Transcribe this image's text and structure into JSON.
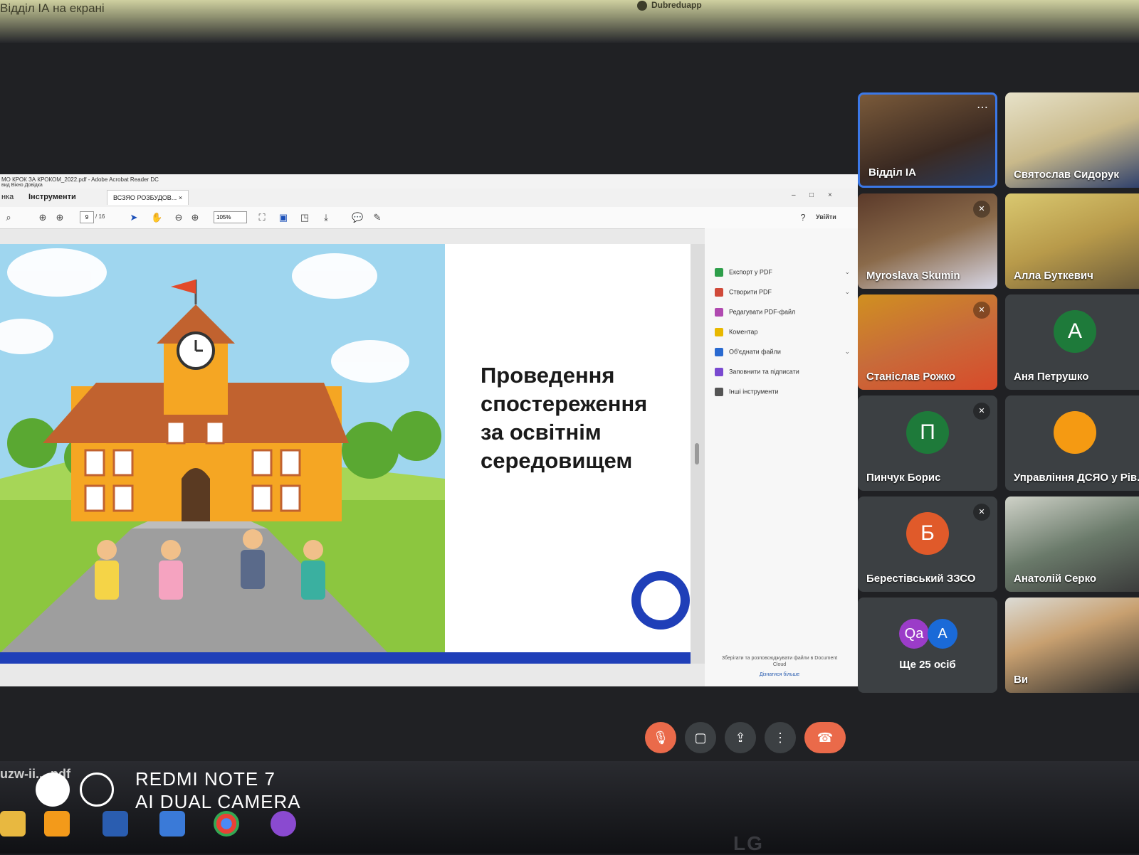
{
  "top": {
    "presenting_label": "Відділ ІА на екрані",
    "brand": "Dubreduapp"
  },
  "window": {
    "title": "МО КРОК ЗА КРОКОМ_2022.pdf - Adobe Acrobat Reader DC",
    "menu": "вид   Вікно   Довідка",
    "tab_home": "нка",
    "tab_tools": "Інструменти",
    "doc_tab": "ВСЗЯО РОЗБУДОВ...",
    "page_current": "9",
    "page_total": "/ 16",
    "zoom": "105%",
    "signin": "Увійти",
    "close_glyph": "×",
    "min_glyph": "–",
    "max_glyph": "□"
  },
  "slide": {
    "title_lines": [
      "Проведення",
      "спостереження",
      "за освітнім",
      "середовищем"
    ],
    "accent": "#1f3fb8"
  },
  "tools_pane": {
    "items": [
      {
        "label": "Експорт у PDF",
        "color": "#2e9e4a",
        "chev": "⌄"
      },
      {
        "label": "Створити PDF",
        "color": "#d04a3a",
        "chev": "⌄"
      },
      {
        "label": "Редагувати PDF-файл",
        "color": "#b04ab0",
        "chev": ""
      },
      {
        "label": "Коментар",
        "color": "#e8b800",
        "chev": ""
      },
      {
        "label": "Об'єднати файли",
        "color": "#2a6ad0",
        "chev": "⌄"
      },
      {
        "label": "Заповнити та підписати",
        "color": "#7a4ad0",
        "chev": ""
      },
      {
        "label": "Інші інструменти",
        "color": "#555555",
        "chev": ""
      }
    ],
    "note": "Зберігати та розповсюджувати файли в Document Cloud",
    "learn": "Дізнатися більше"
  },
  "participants": {
    "t1": {
      "name": "Відділ ІА",
      "more": "⋯"
    },
    "t2": {
      "name": "Святослав Сидорук"
    },
    "t3": {
      "name": "Myroslava Skumin"
    },
    "t4": {
      "name": "Алла Буткевич"
    },
    "t5": {
      "name": "Станіслав Рожко"
    },
    "t6": {
      "name": "Аня Петрушко",
      "initial": "А",
      "color": "#1e7a3a"
    },
    "t7": {
      "name": "Пинчук Борис",
      "initial": "П",
      "color": "#1e7a3a"
    },
    "t8": {
      "name": "Управління ДСЯО у Рів...",
      "initial": "",
      "color": "#f59a12"
    },
    "t9": {
      "name": "Берестівський ЗЗСО",
      "initial": "Б",
      "color": "#e05a2a"
    },
    "t10": {
      "name": "Анатолій Серко"
    },
    "t11": {
      "avatars": [
        {
          "initial": "Qa",
          "color": "#9b3cc8"
        },
        {
          "initial": "A",
          "color": "#1a6ad8"
        }
      ],
      "count": "Ще 25 осіб"
    },
    "t12": {
      "name": "Ви"
    }
  },
  "controls": {
    "mic": "🎙",
    "camera": "▢",
    "present": "⇪",
    "more": "⋮",
    "hangup": "☎"
  },
  "taskbar": {
    "download": "uzw-ii...-pdf"
  },
  "watermark": {
    "line1": "REDMI NOTE 7",
    "line2": "AI DUAL CAMERA"
  },
  "monitor_brand": "LG"
}
